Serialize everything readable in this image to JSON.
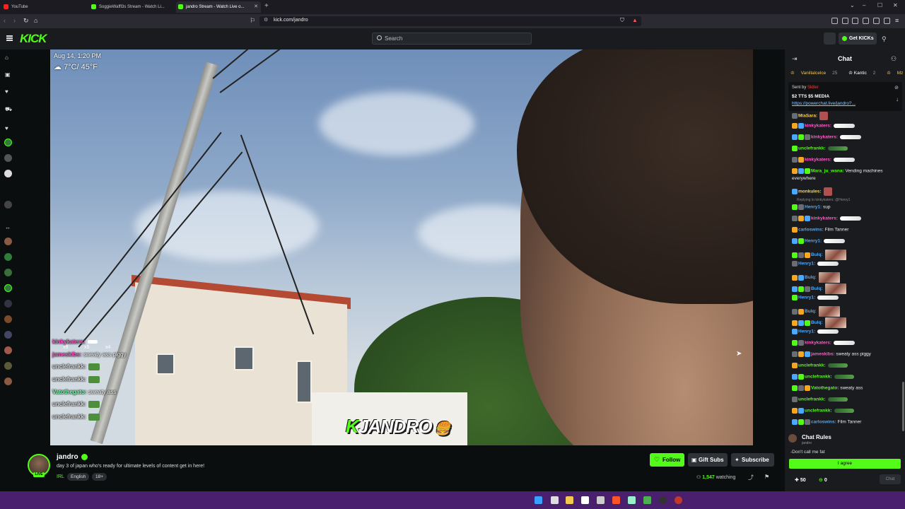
{
  "browser": {
    "tabs": [
      {
        "label": "YouTube",
        "active": false
      },
      {
        "label": "SoggieWaffl3s Stream - Watch Li...",
        "active": false
      },
      {
        "label": "jandro Stream - Watch Live o...",
        "active": true
      }
    ],
    "url": "kick.com/jandro"
  },
  "header": {
    "logo": "KICK",
    "search_placeholder": "Search",
    "get_kicks": "Get KICKs"
  },
  "video": {
    "datetime": "Aug 14, 1:20 PM",
    "weather": "7°C/ 45°F",
    "overlay_logo": "JANDRO",
    "overlay_badges": [
      "x9",
      "x5",
      "x4"
    ],
    "overlay_chat": [
      {
        "user": "kinkykaters:",
        "text": ""
      },
      {
        "user": "jameskibs:",
        "text": "sweaty ass piggy"
      },
      {
        "user": "unclefrankk:",
        "text": ""
      },
      {
        "user": "unclefrankk:",
        "text": ""
      },
      {
        "user": "Vatothegato:",
        "text": "sweaty ass"
      },
      {
        "user": "unclefrankk:",
        "text": ""
      },
      {
        "user": "unclefrankk:",
        "text": ""
      }
    ]
  },
  "stream": {
    "name": "jandro",
    "live": "LIVE",
    "title": "day 3 of japan who's ready for ultimate levels of content get in here!",
    "category": "IRL",
    "tags": [
      "English",
      "18+"
    ],
    "follow": "Follow",
    "gift": "Gift Subs",
    "subscribe": "Subscribe",
    "viewers": "1,547",
    "watching_label": "watching"
  },
  "chat": {
    "title": "Chat",
    "leaderboard": [
      {
        "name": "Vanillalcelce",
        "count": "25"
      },
      {
        "name": "Kantic",
        "count": "2"
      },
      {
        "name": "Mz",
        "count": ""
      }
    ],
    "pinned": {
      "sent_by": "Sent by",
      "sender": "Sk8er",
      "amount": "$2 TTS $5 MEDIA",
      "link": "https://powerchat.live/jandro?..."
    },
    "messages": [
      {
        "user": "MiaSara:",
        "color": "#ffd54a",
        "text": "",
        "emote": "avt"
      },
      {
        "user": "kinkykaters:",
        "color": "#ff5ac8",
        "text": "",
        "emote": "w"
      },
      {
        "user": "kinkykaters:",
        "color": "#ff5ac8",
        "text": "",
        "emote": "w"
      },
      {
        "user": "unclefrankk:",
        "color": "#53fc18",
        "text": "",
        "emote": "g"
      },
      {
        "user": "kinkykaters:",
        "color": "#ff5ac8",
        "text": "",
        "emote": "w"
      },
      {
        "user": "Mara_ju_wana:",
        "color": "#53fc18",
        "text": "Vending machines",
        "text2": "everywhere",
        "emote": ""
      },
      {
        "user": "monkules:",
        "color": "#ffd54a",
        "text": "",
        "emote": "avt"
      },
      {
        "user": "Henry1:",
        "color": "#4aa8ff",
        "text": "sup",
        "reply": "Replying to kinkykaters: @Henry1",
        "emote": ""
      },
      {
        "user": "kinkykaters:",
        "color": "#ff5ac8",
        "text": "",
        "emote": "w"
      },
      {
        "user": "carloswins:",
        "color": "#4aa8ff",
        "text": "Film Tanner",
        "emote": ""
      },
      {
        "user": "Henry1:",
        "color": "#4aa8ff",
        "text": "",
        "emote": "w"
      },
      {
        "user": "Bulq:",
        "color": "#4aa8ff",
        "text": "",
        "emote": "img"
      },
      {
        "user": "Henry1:",
        "color": "#4aa8ff",
        "text": "",
        "emote": "w"
      },
      {
        "user": "Bulq:",
        "color": "#4aa8ff",
        "text": "",
        "emote": "img"
      },
      {
        "user": "Bulq:",
        "color": "#4aa8ff",
        "text": "",
        "emote": "img"
      },
      {
        "user": "Henry1:",
        "color": "#4aa8ff",
        "text": "",
        "emote": "w"
      },
      {
        "user": "Bulq:",
        "color": "#4aa8ff",
        "text": "",
        "emote": "img"
      },
      {
        "user": "Bulq:",
        "color": "#4aa8ff",
        "text": "",
        "emote": "img"
      },
      {
        "user": "Henry1:",
        "color": "#4aa8ff",
        "text": "",
        "emote": "w"
      },
      {
        "user": "kinkykaters:",
        "color": "#ff5ac8",
        "text": "",
        "emote": "w"
      },
      {
        "user": "jameskibs:",
        "color": "#ff5ac8",
        "text": "sweaty ass piggy",
        "emote": ""
      },
      {
        "user": "unclefrankk:",
        "color": "#53fc18",
        "text": "",
        "emote": "g"
      },
      {
        "user": "unclefrankk:",
        "color": "#53fc18",
        "text": "",
        "emote": "g"
      },
      {
        "user": "Vatothegato:",
        "color": "#53fc18",
        "text": "sweaty ass",
        "emote": ""
      },
      {
        "user": "unclefrankk:",
        "color": "#53fc18",
        "text": "",
        "emote": "g"
      },
      {
        "user": "unclefrankk:",
        "color": "#53fc18",
        "text": "",
        "emote": "g"
      },
      {
        "user": "carloswins:",
        "color": "#4aa8ff",
        "text": "Film Tanner",
        "emote": ""
      }
    ],
    "rules": {
      "title": "Chat Rules",
      "by": "jandro",
      "text": "-Don't call me fat",
      "agree": "I agree"
    },
    "kicks_balance": "50",
    "points": "0",
    "send": "Chat"
  },
  "colors": {
    "accent": "#53fc18",
    "background": "#0b0e0f",
    "panel": "#191b1f",
    "taskbar": "#4a1f6e"
  }
}
